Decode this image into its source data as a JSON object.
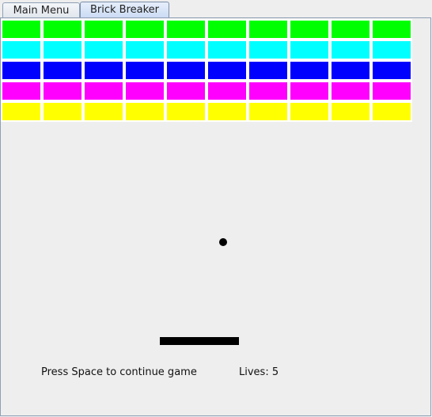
{
  "tabs": [
    {
      "label": "Main Menu"
    },
    {
      "label": "Brick Breaker"
    }
  ],
  "game": {
    "brick_rows": [
      {
        "color": "#00ff00",
        "count": 10
      },
      {
        "color": "#00ffff",
        "count": 10
      },
      {
        "color": "#0000ff",
        "count": 10
      },
      {
        "color": "#ff00ff",
        "count": 10
      },
      {
        "color": "#ffff00",
        "count": 10
      }
    ],
    "message": "Press Space to continue game",
    "lives_label": "Lives: 5",
    "colors": {
      "ball": "#000000",
      "paddle": "#000000",
      "background": "#eeeeee"
    }
  }
}
